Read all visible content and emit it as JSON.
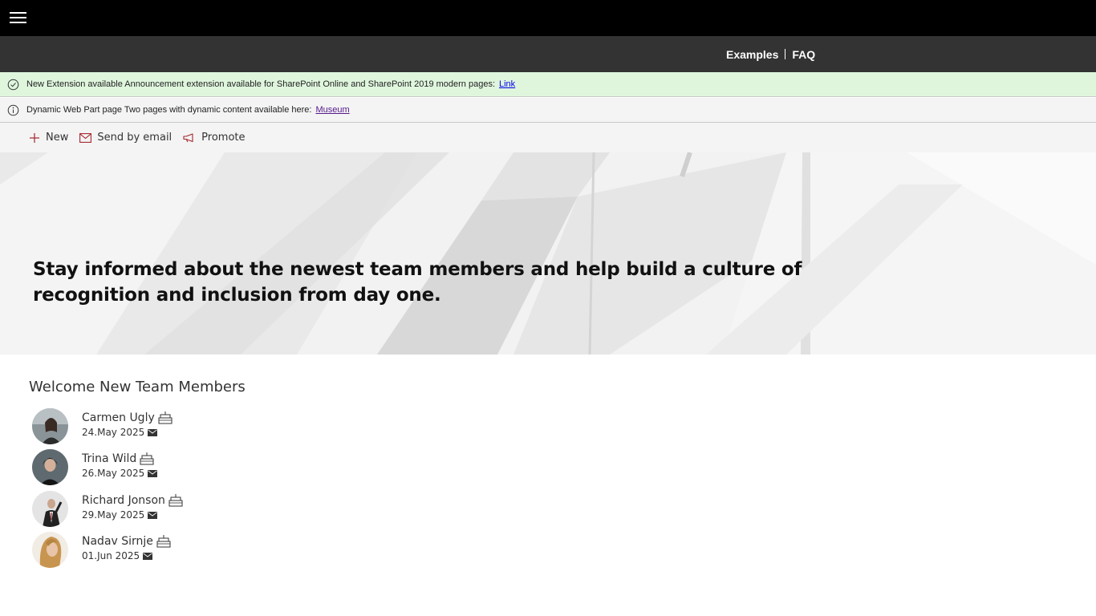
{
  "nav": {
    "examples": "Examples",
    "faq": "FAQ"
  },
  "banners": [
    {
      "text": "New Extension available Announcement extension available for SharePoint Online and SharePoint 2019 modern pages:",
      "link": "Link"
    },
    {
      "text": "Dynamic Web Part page Two pages with dynamic content available here:",
      "link": "Museum"
    }
  ],
  "commands": {
    "new": "New",
    "send_by_email": "Send by email",
    "promote": "Promote"
  },
  "hero": {
    "text": "Stay informed about the newest team members and help build a culture of recognition and inclusion from day one."
  },
  "section": {
    "title": "Welcome New Team Members"
  },
  "members": [
    {
      "name": "Carmen Ugly",
      "date": "24.May 2025"
    },
    {
      "name": "Trina Wild",
      "date": "26.May 2025"
    },
    {
      "name": "Richard Jonson",
      "date": "29.May 2025"
    },
    {
      "name": "Nadav Sirnje",
      "date": "01.Jun 2025"
    }
  ],
  "icons": {
    "menu": "hamburger-menu-icon",
    "success": "check-circle-icon",
    "info": "info-icon",
    "new": "plus-icon",
    "email": "mail-icon",
    "promote": "megaphone-icon",
    "cake": "birthday-cake-icon"
  },
  "colors": {
    "topbar": "#000000",
    "navbar": "#333333",
    "success_banner": "#dff6dd",
    "accent": "#a4262c"
  }
}
